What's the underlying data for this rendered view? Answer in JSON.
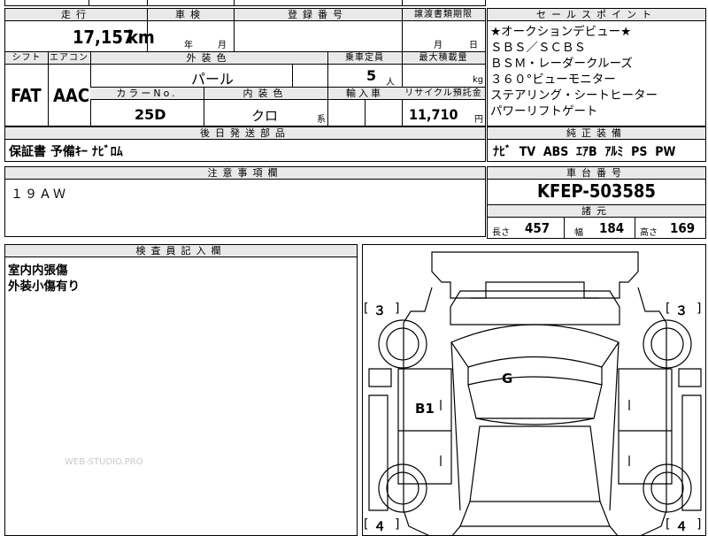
{
  "top_row": {
    "left_partial": ""
  },
  "mileage": {
    "label": "走行",
    "value": "17,157",
    "unit": "km"
  },
  "inspection": {
    "label": "車検",
    "year": "年",
    "month": "月"
  },
  "registration": {
    "label": "登録番号",
    "value": ""
  },
  "transfer_deadline": {
    "label": "譲渡書類期限",
    "month": "月",
    "day": "日"
  },
  "sales_points": {
    "label": "セールスポイント",
    "items": [
      "★オークションデビュー★",
      "ＳＢＳ／ＳＣＢＳ",
      "ＢＳＭ・レーダークルーズ",
      "３６０°ビューモニター",
      "ステアリング・シートヒーター",
      "パワーリフトゲート"
    ]
  },
  "shift": {
    "label": "シフト",
    "value": "FAT"
  },
  "aircon": {
    "label": "エアコン",
    "value": "AAC"
  },
  "exterior_color": {
    "label": "外装色",
    "value": "パール"
  },
  "capacity": {
    "label": "乗車定員",
    "value": "5",
    "unit": "人"
  },
  "max_load": {
    "label": "最大積載量",
    "value": "",
    "unit": "kg"
  },
  "color_no": {
    "label": "カラーNo.",
    "value": "25D"
  },
  "interior_color": {
    "label": "内装色",
    "value": "クロ",
    "suffix": "系"
  },
  "import_car": {
    "label": "輸入車",
    "value": ""
  },
  "recycle": {
    "label": "リサイクル預託金",
    "value": "11,710",
    "unit": "円"
  },
  "post_shipping": {
    "label": "後日発送部品",
    "value": "保証書 予備ｷｰ ﾅﾋﾞﾛﾑ"
  },
  "genuine_equipment": {
    "label": "純正装備",
    "value": "ﾅﾋﾞ  TV  ABS  ｴｱB  ｱﾙﾐ  PS  PW"
  },
  "notes": {
    "label": "注意事項欄",
    "value": "１９ＡＷ"
  },
  "chassis": {
    "label": "車台番号",
    "value": "KFEP-503585"
  },
  "specs": {
    "label": "諸元",
    "length_label": "長さ",
    "length": "457",
    "width_label": "幅",
    "width": "184",
    "height_label": "高さ",
    "height": "169"
  },
  "inspector": {
    "label": "検査員記入欄",
    "lines": [
      "室内内張傷",
      "外装小傷有り"
    ]
  },
  "diagram": {
    "marks": {
      "front_left": "３",
      "front_right": "３",
      "rear_left": "４",
      "rear_right": "４",
      "bracket_open": "[",
      "bracket_close": "]"
    },
    "damage_g": "G",
    "damage_b1": "B1"
  },
  "watermark": "WEB-STUDIO.PRO"
}
